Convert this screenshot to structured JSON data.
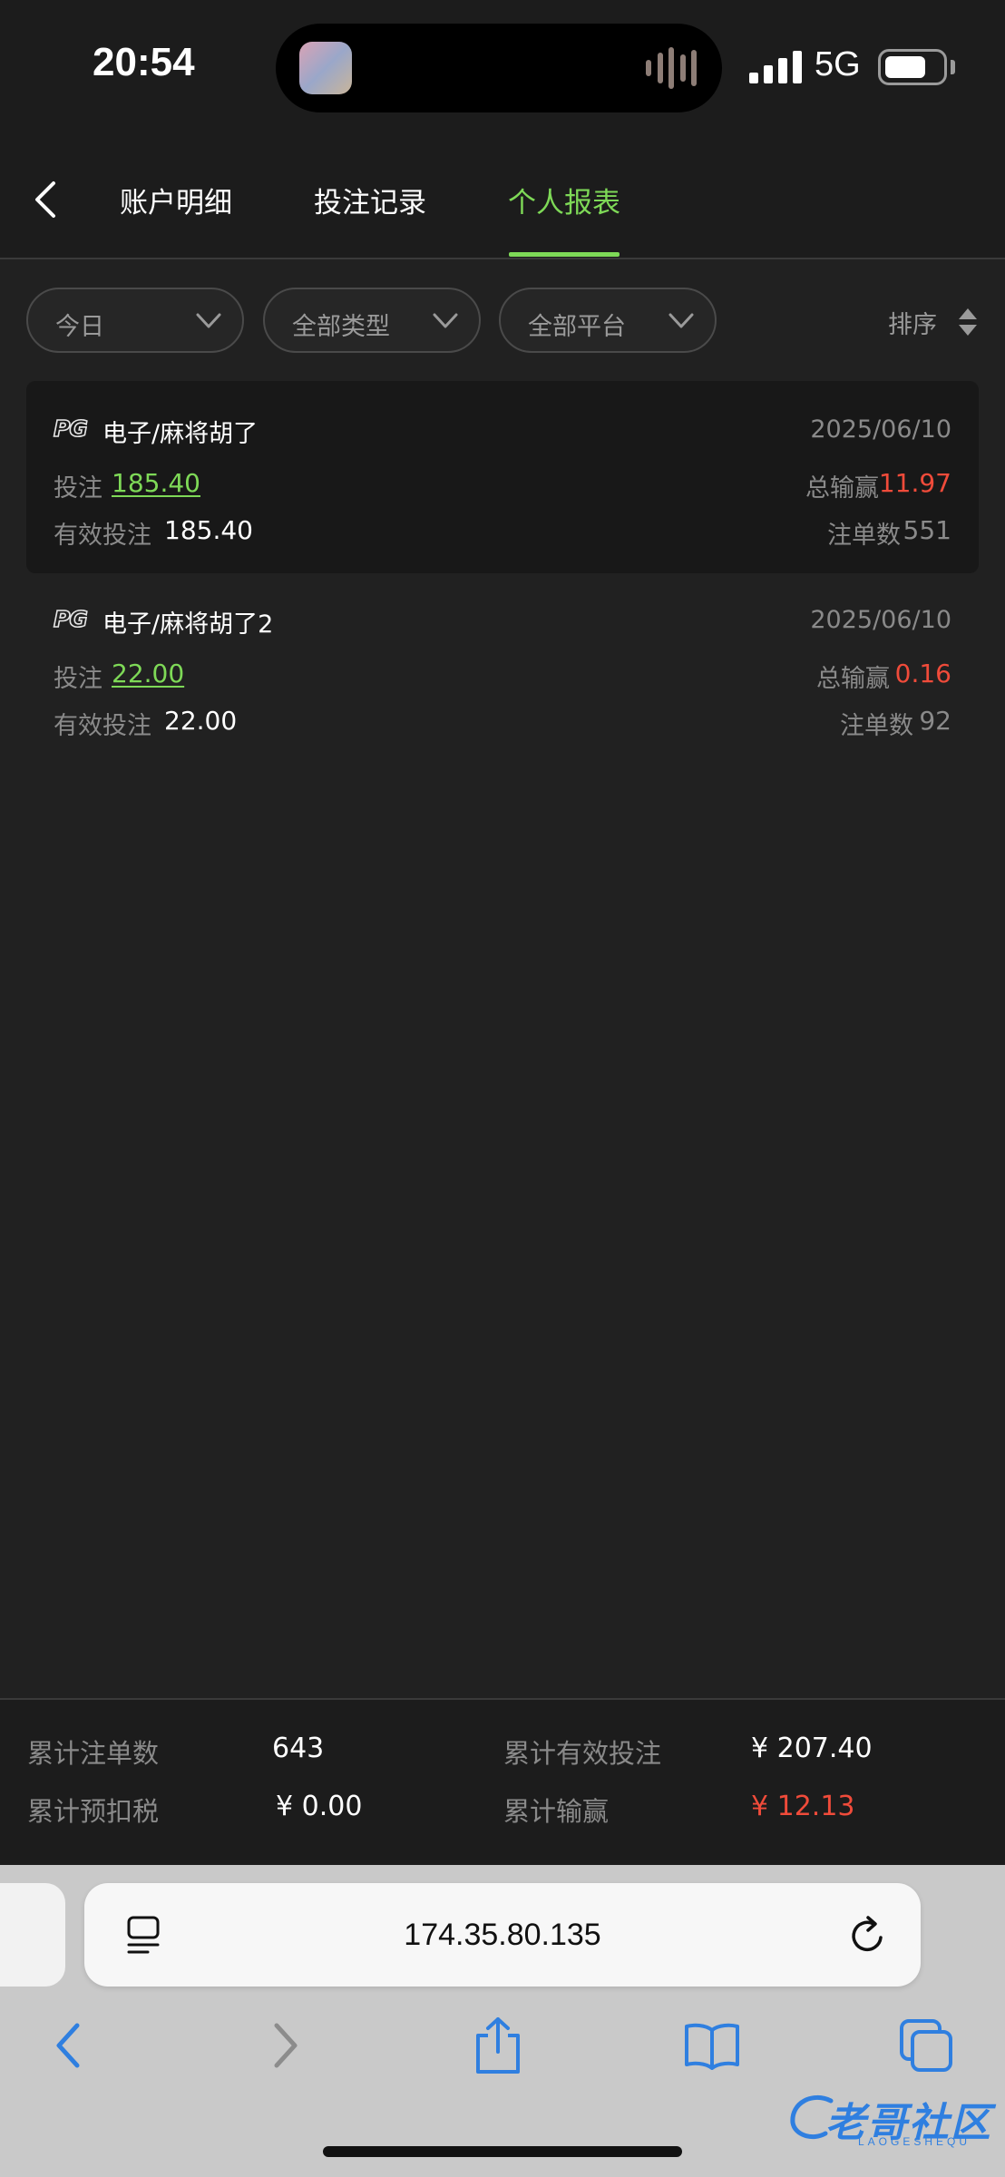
{
  "status_bar": {
    "time": "20:54",
    "network": "5G"
  },
  "nav": {
    "tabs": [
      {
        "label": "账户明细"
      },
      {
        "label": "投注记录"
      },
      {
        "label": "个人报表"
      }
    ],
    "active_tab": "个人报表"
  },
  "filters": {
    "period": "今日",
    "type": "全部类型",
    "platform": "全部平台",
    "sort_label": "排序"
  },
  "records": [
    {
      "provider_logo": "PG",
      "game": "电子/麻将胡了",
      "date": "2025/06/10",
      "bet_label": "投注",
      "bet": "185.40",
      "win_label": "总输赢",
      "win": "11.97",
      "valid_label": "有效投注",
      "valid_bet": "185.40",
      "count_label": "注单数",
      "count": "551"
    },
    {
      "provider_logo": "PG",
      "game": "电子/麻将胡了2",
      "date": "2025/06/10",
      "bet_label": "投注",
      "bet": "22.00",
      "win_label": "总输赢",
      "win": "0.16",
      "valid_label": "有效投注",
      "valid_bet": "22.00",
      "count_label": "注单数",
      "count": "92"
    }
  ],
  "summary": {
    "total_count_label": "累计注单数",
    "total_count": "643",
    "total_valid_label": "累计有效投注",
    "total_valid": "¥ 207.40",
    "total_tax_label": "累计预扣税",
    "total_tax": "¥ 0.00",
    "total_win_label": "累计输赢",
    "total_win": "¥ 12.13"
  },
  "browser": {
    "url": "174.35.80.135"
  },
  "watermark": {
    "text": "老哥社区",
    "sub": "LAOGESHEQU"
  },
  "colors": {
    "accent": "#7ed957",
    "negative": "#f04b3a",
    "background": "#212121",
    "ios_blue": "#2f7fe0"
  }
}
